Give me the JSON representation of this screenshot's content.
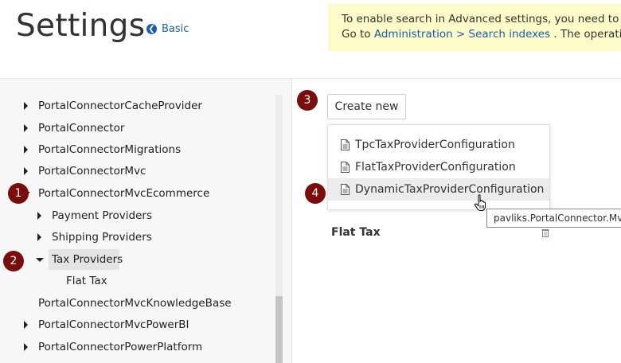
{
  "header": {
    "title": "Settings",
    "basic_link": "Basic",
    "notice_line1": "To enable search in Advanced settings, you need to re",
    "notice_line2_prefix": "Go to ",
    "notice_link": "Administration > Search indexes",
    "notice_line2_suffix": ". The operatio"
  },
  "tree": {
    "items": [
      {
        "label": "PortalConnectorCacheProvider",
        "expanded": false
      },
      {
        "label": "PortalConnector",
        "expanded": false
      },
      {
        "label": "PortalConnectorMigrations",
        "expanded": false
      },
      {
        "label": "PortalConnectorMvc",
        "expanded": false
      },
      {
        "label": "PortalConnectorMvcEcommerce",
        "expanded": true
      },
      {
        "label": "Payment Providers",
        "expanded": false
      },
      {
        "label": "Shipping Providers",
        "expanded": false
      },
      {
        "label": "Tax Providers",
        "expanded": true,
        "selected": true
      },
      {
        "label": "Flat Tax"
      },
      {
        "label": "PortalConnectorMvcKnowledgeBase"
      },
      {
        "label": "PortalConnectorMvcPowerBI",
        "expanded": false
      },
      {
        "label": "PortalConnectorPowerPlatform",
        "expanded": false
      }
    ]
  },
  "steps": [
    "1",
    "2",
    "3",
    "4"
  ],
  "main": {
    "create_button": "Create new",
    "dropdown_items": [
      "TpcTaxProviderConfiguration",
      "FlatTaxProviderConfiguration",
      "DynamicTaxProviderConfiguration"
    ],
    "hovered_item": "DynamicTaxProviderConfiguration",
    "tooltip": "pavliks.PortalConnector.Mvc",
    "section_label": "Flat Tax"
  },
  "colors": {
    "accent": "#1a5fa8",
    "notice_bg": "#fdfcc8",
    "badge": "#7a0c0c"
  },
  "icons": {
    "basic_link": "arrow-left-circle-icon",
    "dropdown_item": "document-icon",
    "delete": "trash-icon",
    "pointer": "hand-cursor-icon"
  }
}
